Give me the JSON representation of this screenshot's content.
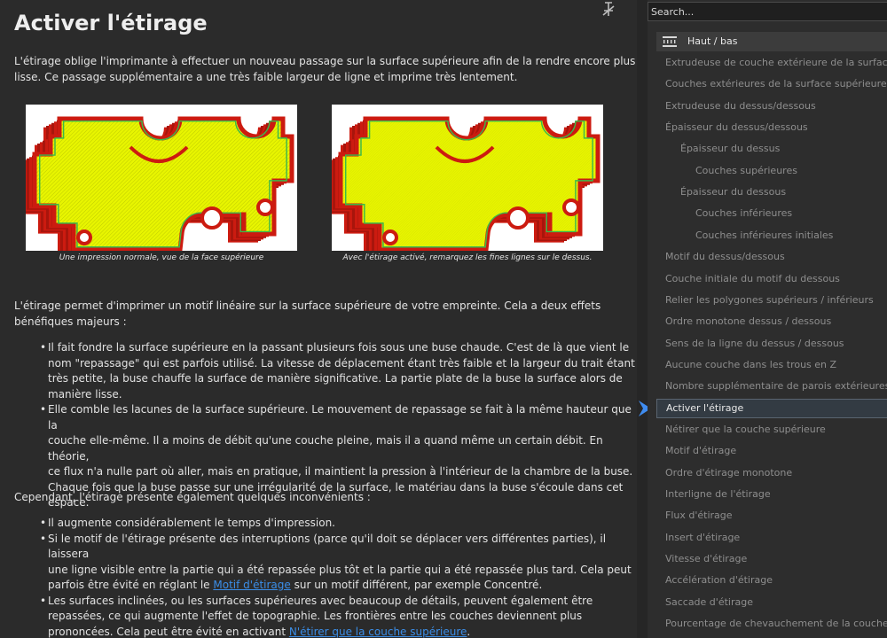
{
  "main": {
    "title": "Activer l'étirage",
    "intro": [
      "L'étirage oblige l'imprimante à effectuer un nouveau passage sur la surface supérieure afin de la rendre encore plus",
      "lisse. Ce passage supplémentaire a une très faible largeur de ligne et imprime très lentement."
    ],
    "figures": [
      {
        "caption": "Une impression normale, vue de la face supérieure"
      },
      {
        "caption": "Avec l'étirage activé, remarquez les fines lignes sur le dessus."
      }
    ],
    "para2": [
      "L'étirage permet d'imprimer un motif linéaire sur la surface supérieure de votre empreinte. Cela a deux effets",
      "bénéfiques majeurs :"
    ],
    "bullets1": [
      [
        "Il fait fondre la surface supérieure en la passant plusieurs fois sous une buse chaude. C'est de là que vient le",
        "nom \"repassage\" qui est parfois utilisé. La vitesse de déplacement étant très faible et la largeur du trait étant",
        "très petite, la buse chauffe la surface de manière significative. La partie plate de la buse la surface alors de",
        "manière lisse."
      ],
      [
        "Elle comble les lacunes de la surface supérieure. Le mouvement de repassage se fait à la même hauteur que la",
        "couche elle-même. Il a moins de débit qu'une couche pleine, mais il a quand même un certain débit. En théorie,",
        "ce flux n'a nulle part où aller, mais en pratique, il maintient la pression à l'intérieur de la chambre de la buse.",
        "Chaque fois que la buse passe sur une irrégularité de la surface, le matériau dans la buse s'écoule dans cet",
        "espace."
      ]
    ],
    "para3": "Cependant, l'étirage présente également quelques inconvénients :",
    "bullets2": {
      "b1": "Il augmente considérablement le temps d'impression.",
      "b2_lines": [
        "Si le motif de l'étirage présente des interruptions (parce qu'il doit se déplacer vers différentes parties), il laissera",
        "une ligne visible entre la partie qui a été repassée plus tôt et la partie qui a été repassée plus tard. Cela peut"
      ],
      "b2_pre": "parfois être évité en réglant le ",
      "b2_link": "Motif d'étirage",
      "b2_post": " sur un motif différent, par exemple Concentré.",
      "b3_lines": [
        "Les surfaces inclinées, ou les surfaces supérieures avec beaucoup de détails, peuvent également être",
        "repassées, ce qui augmente l'effet de topographie. Les frontières entre les couches deviennent plus"
      ],
      "b3_pre": "prononcées. Cela peut être évité en activant ",
      "b3_link": "N'étirer que la couche supérieure",
      "b3_post": "."
    }
  },
  "sidebar": {
    "search_placeholder": "Search...",
    "category": {
      "label": "Haut / bas",
      "icon": "top-bottom-icon"
    },
    "items": [
      {
        "label": "Extrudeuse de couche extérieure de la surface supérieure",
        "level": 0
      },
      {
        "label": "Couches extérieures de la surface supérieure",
        "level": 0
      },
      {
        "label": "Extrudeuse du dessus/dessous",
        "level": 0
      },
      {
        "label": "Épaisseur du dessus/dessous",
        "level": 0
      },
      {
        "label": "Épaisseur du dessus",
        "level": 1
      },
      {
        "label": "Couches supérieures",
        "level": 2
      },
      {
        "label": "Épaisseur du dessous",
        "level": 1
      },
      {
        "label": "Couches inférieures",
        "level": 2
      },
      {
        "label": "Couches inférieures initiales",
        "level": 2
      },
      {
        "label": "Motif du dessus/dessous",
        "level": 0
      },
      {
        "label": "Couche initiale du motif du dessous",
        "level": 0
      },
      {
        "label": "Relier les polygones supérieurs / inférieurs",
        "level": 0
      },
      {
        "label": "Ordre monotone dessus / dessous",
        "level": 0
      },
      {
        "label": "Sens de la ligne du dessus / dessous",
        "level": 0
      },
      {
        "label": "Aucune couche dans les trous en Z",
        "level": 0
      },
      {
        "label": "Nombre supplémentaire de parois extérieures",
        "level": 0
      },
      {
        "label": "Activer l'étirage",
        "level": 0,
        "selected": true
      },
      {
        "label": "Nétirer que la couche supérieure",
        "level": 0
      },
      {
        "label": "Motif d'étirage",
        "level": 0
      },
      {
        "label": "Ordre d'étirage monotone",
        "level": 0
      },
      {
        "label": "Interligne de l'étirage",
        "level": 0
      },
      {
        "label": "Flux d'étirage",
        "level": 0
      },
      {
        "label": "Insert d'étirage",
        "level": 0
      },
      {
        "label": "Vitesse d'étirage",
        "level": 0
      },
      {
        "label": "Accélération d'étirage",
        "level": 0
      },
      {
        "label": "Saccade d'étirage",
        "level": 0
      },
      {
        "label": "Pourcentage de chevauchement de la couche extérieure",
        "level": 0
      }
    ]
  },
  "colors": {
    "accent": "#3d8ee8",
    "selection_arrow": "#3f8cf0",
    "print_yellow": "#e8f500",
    "print_red": "#cc1b10",
    "print_green": "#3bb84a"
  }
}
